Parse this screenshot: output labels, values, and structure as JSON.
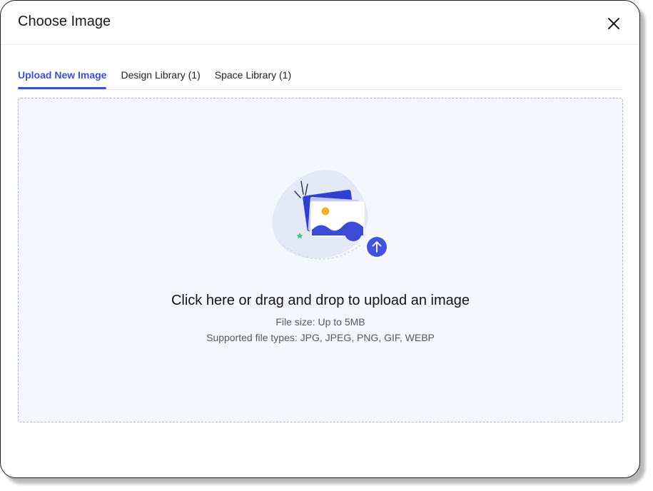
{
  "dialog": {
    "title": "Choose Image",
    "close_icon": "close-icon"
  },
  "tabs": [
    {
      "label": "Upload New Image",
      "active": true
    },
    {
      "label": "Design Library (1)",
      "active": false
    },
    {
      "label": "Space Library (1)",
      "active": false
    }
  ],
  "dropzone": {
    "illustration_icon": "image-upload-icon",
    "prompt": "Click here or drag and drop to upload an image",
    "file_size": "File size: Up to 5MB",
    "file_types": "Supported file types: JPG, JPEG, PNG, GIF, WEBP"
  },
  "colors": {
    "accent": "#3d4fd9",
    "dropzone_bg": "#f4f7fd",
    "dropzone_border": "#a9b1e6"
  }
}
